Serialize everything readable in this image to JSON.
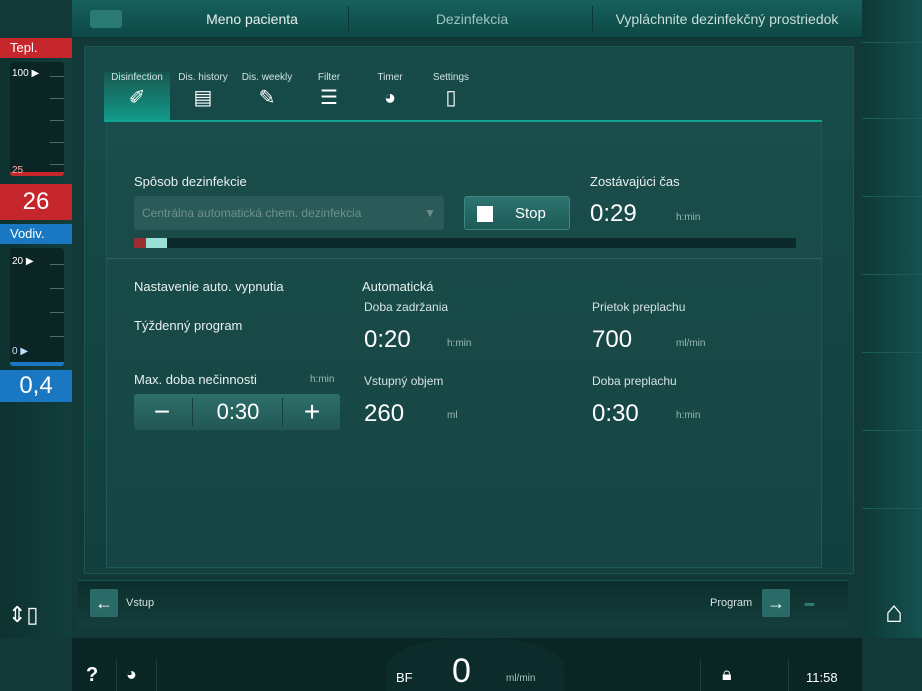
{
  "topbar": {
    "patient_name": "Meno pacienta",
    "mode": "Dezinfekcia",
    "message": "Vypláchnite dezinfekčný prostriedok"
  },
  "left_panel": {
    "temp": {
      "label": "Tepl.",
      "scale_top": "100",
      "scale_bottom": "25",
      "value": "26"
    },
    "conductivity": {
      "label": "Vodiv.",
      "scale_top": "20",
      "scale_bottom": "0",
      "value": "0,4"
    }
  },
  "tabs": [
    {
      "label": "Disinfection",
      "icon": "disinfection-icon",
      "glyph": "✐"
    },
    {
      "label": "Dis. history",
      "icon": "history-icon",
      "glyph": "▤"
    },
    {
      "label": "Dis. weekly",
      "icon": "weekly-icon",
      "glyph": "✎"
    },
    {
      "label": "Filter",
      "icon": "filter-icon",
      "glyph": "☰"
    },
    {
      "label": "Timer",
      "icon": "timer-icon",
      "glyph": "◕"
    },
    {
      "label": "Settings",
      "icon": "settings-icon",
      "glyph": "▯"
    }
  ],
  "disinfection": {
    "method_label": "Spôsob dezinfekcie",
    "method_value": "Centrálna automatická chem. dezinfekcia",
    "stop_label": "Stop",
    "remaining_label": "Zostávajúci čas",
    "remaining_value": "0:29",
    "remaining_unit": "h:min",
    "progress_fraction": 0.05
  },
  "settings": {
    "auto_off_label": "Nastavenie auto. vypnutia",
    "auto_off_value": "Automatická",
    "weekly_label": "Týždenný program",
    "max_idle_label": "Max. doba nečinnosti",
    "max_idle_unit": "h:min",
    "max_idle_value": "0:30",
    "minus": "−",
    "plus": "+",
    "hold_label": "Doba zadržania",
    "hold_value": "0:20",
    "hold_unit": "h:min",
    "intake_label": "Vstupný objem",
    "intake_value": "260",
    "intake_unit": "ml",
    "rinse_flow_label": "Prietok preplachu",
    "rinse_flow_value": "700",
    "rinse_flow_unit": "ml/min",
    "rinse_time_label": "Doba preplachu",
    "rinse_time_value": "0:30",
    "rinse_time_unit": "h:min"
  },
  "nav": {
    "back_label": "Vstup",
    "forward_label": "Program"
  },
  "statusbar": {
    "help": "?",
    "bf_label": "BF",
    "bf_value": "0",
    "bf_unit": "ml/min",
    "time": "11:58"
  },
  "colors": {
    "accent": "#10a290",
    "alarm_red": "#d7262c",
    "info_blue": "#1a78c2"
  }
}
